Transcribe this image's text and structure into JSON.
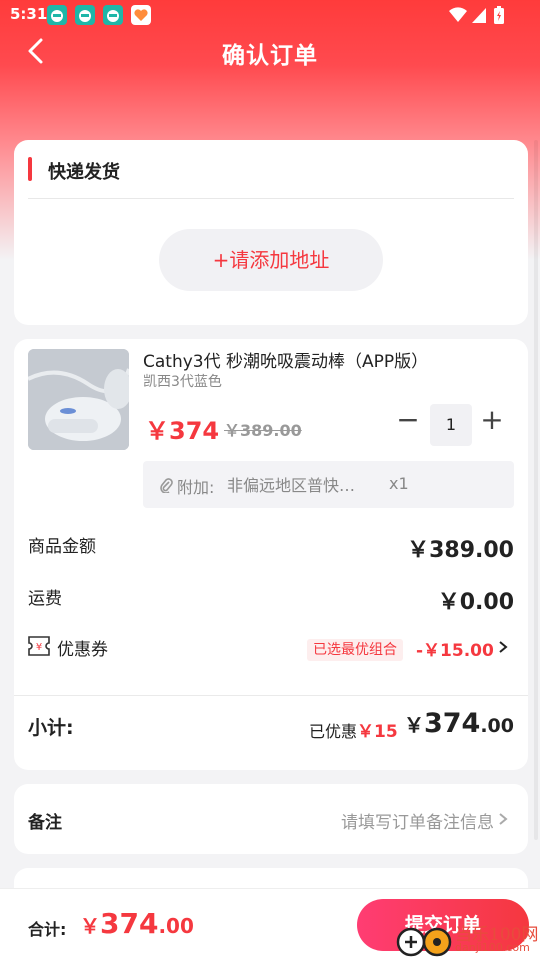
{
  "status_bar": {
    "time": "5:31"
  },
  "header": {
    "title": "确认订单"
  },
  "address_card": {
    "heading": "快递发货",
    "add_button": "+请添加地址"
  },
  "product": {
    "title": "Cathy3代 秒潮吮吸震动棒（APP版）",
    "spec": "凯西3代蓝色",
    "price": "￥374",
    "original_price": "￥389.00",
    "quantity": "1",
    "addon_label": "附加:",
    "addon_value": "非偏远地区普快…",
    "addon_qty": "x1"
  },
  "summary": {
    "goods_label": "商品金额",
    "goods_value": "￥389.00",
    "shipping_label": "运费",
    "shipping_value": "￥0.00",
    "coupon_label": "优惠券",
    "coupon_tag": "已选最优组合",
    "coupon_value": "-￥15.00",
    "subtotal_label": "小计:",
    "saved_prefix": "已优惠",
    "saved_amount": "￥15",
    "subtotal_currency": "￥",
    "subtotal_int": "374",
    "subtotal_dec": ".00"
  },
  "remark": {
    "label": "备注",
    "placeholder": "请填写订单备注信息"
  },
  "bottom": {
    "total_label": "合计:",
    "total_currency": "￥",
    "total_int": "374",
    "total_dec": ".00",
    "submit": "提交订单"
  },
  "watermark": {
    "text": "当乐100网",
    "url": "danji100.com"
  },
  "colors": {
    "accent": "#f5383f",
    "header_red": "#ff3b3b"
  }
}
